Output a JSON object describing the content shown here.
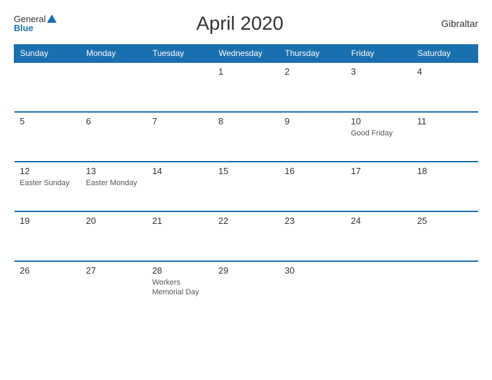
{
  "header": {
    "logo_general": "General",
    "logo_blue": "Blue",
    "title": "April 2020",
    "country": "Gibraltar"
  },
  "columns": [
    "Sunday",
    "Monday",
    "Tuesday",
    "Wednesday",
    "Thursday",
    "Friday",
    "Saturday"
  ],
  "rows": [
    [
      {
        "num": "",
        "event": ""
      },
      {
        "num": "",
        "event": ""
      },
      {
        "num": "1",
        "event": ""
      },
      {
        "num": "2",
        "event": ""
      },
      {
        "num": "3",
        "event": ""
      },
      {
        "num": "4",
        "event": ""
      }
    ],
    [
      {
        "num": "5",
        "event": ""
      },
      {
        "num": "6",
        "event": ""
      },
      {
        "num": "7",
        "event": ""
      },
      {
        "num": "8",
        "event": ""
      },
      {
        "num": "9",
        "event": ""
      },
      {
        "num": "10",
        "event": "Good Friday"
      },
      {
        "num": "11",
        "event": ""
      }
    ],
    [
      {
        "num": "12",
        "event": "Easter Sunday"
      },
      {
        "num": "13",
        "event": "Easter Monday"
      },
      {
        "num": "14",
        "event": ""
      },
      {
        "num": "15",
        "event": ""
      },
      {
        "num": "16",
        "event": ""
      },
      {
        "num": "17",
        "event": ""
      },
      {
        "num": "18",
        "event": ""
      }
    ],
    [
      {
        "num": "19",
        "event": ""
      },
      {
        "num": "20",
        "event": ""
      },
      {
        "num": "21",
        "event": ""
      },
      {
        "num": "22",
        "event": ""
      },
      {
        "num": "23",
        "event": ""
      },
      {
        "num": "24",
        "event": ""
      },
      {
        "num": "25",
        "event": ""
      }
    ],
    [
      {
        "num": "26",
        "event": ""
      },
      {
        "num": "27",
        "event": ""
      },
      {
        "num": "28",
        "event": "Workers Memorial Day"
      },
      {
        "num": "29",
        "event": ""
      },
      {
        "num": "30",
        "event": ""
      },
      {
        "num": "",
        "event": ""
      },
      {
        "num": "",
        "event": ""
      }
    ]
  ]
}
